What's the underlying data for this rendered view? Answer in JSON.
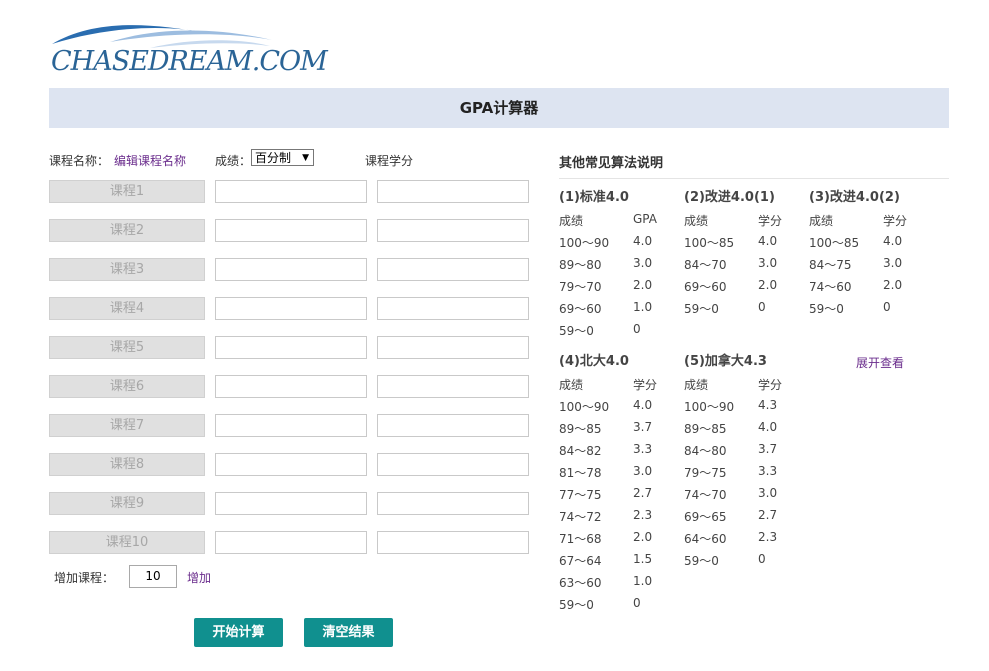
{
  "logo_text": "CHASEDREAM.COM",
  "banner_title": "GPA计算器",
  "form": {
    "course_name_label": "课程名称：",
    "edit_course_names": "编辑课程名称",
    "score_label": "成绩：",
    "score_select": "百分制",
    "credit_header": "课程学分",
    "courses": [
      "课程1",
      "课程2",
      "课程3",
      "课程4",
      "课程5",
      "课程6",
      "课程7",
      "课程8",
      "课程9",
      "课程10"
    ],
    "add_label": "增加课程：",
    "add_value": "10",
    "add_link": "增加",
    "calc_button": "开始计算",
    "clear_button": "清空结果"
  },
  "side": {
    "title": "其他常见算法说明",
    "expand_link": "展开查看",
    "methods": [
      {
        "title": "(1)标准4.0",
        "headers": [
          "成绩",
          "GPA"
        ],
        "rows": [
          [
            "100～90",
            "4.0"
          ],
          [
            "89～80",
            "3.0"
          ],
          [
            "79～70",
            "2.0"
          ],
          [
            "69～60",
            "1.0"
          ],
          [
            "59～0",
            "0"
          ]
        ]
      },
      {
        "title": "(2)改进4.0(1)",
        "headers": [
          "成绩",
          "学分"
        ],
        "rows": [
          [
            "100～85",
            "4.0"
          ],
          [
            "84～70",
            "3.0"
          ],
          [
            "69～60",
            "2.0"
          ],
          [
            "59～0",
            "0"
          ]
        ]
      },
      {
        "title": "(3)改进4.0(2)",
        "headers": [
          "成绩",
          "学分"
        ],
        "rows": [
          [
            "100～85",
            "4.0"
          ],
          [
            "84～75",
            "3.0"
          ],
          [
            "74～60",
            "2.0"
          ],
          [
            "59～0",
            "0"
          ]
        ]
      },
      {
        "title": "(4)北大4.0",
        "headers": [
          "成绩",
          "学分"
        ],
        "rows": [
          [
            "100～90",
            "4.0"
          ],
          [
            "89～85",
            "3.7"
          ],
          [
            "84～82",
            "3.3"
          ],
          [
            "81～78",
            "3.0"
          ],
          [
            "77～75",
            "2.7"
          ],
          [
            "74～72",
            "2.3"
          ],
          [
            "71～68",
            "2.0"
          ],
          [
            "67～64",
            "1.5"
          ],
          [
            "63～60",
            "1.0"
          ],
          [
            "59～0",
            "0"
          ]
        ]
      },
      {
        "title": "(5)加拿大4.3",
        "headers": [
          "成绩",
          "学分"
        ],
        "rows": [
          [
            "100～90",
            "4.3"
          ],
          [
            "89～85",
            "4.0"
          ],
          [
            "84～80",
            "3.7"
          ],
          [
            "79～75",
            "3.3"
          ],
          [
            "74～70",
            "3.0"
          ],
          [
            "69～65",
            "2.7"
          ],
          [
            "64～60",
            "2.3"
          ],
          [
            "59～0",
            "0"
          ]
        ]
      }
    ]
  },
  "colors": {
    "banner": "#dde4f1",
    "button": "#10908f",
    "link": "#6a2c8c",
    "logo": "#2a6496"
  }
}
